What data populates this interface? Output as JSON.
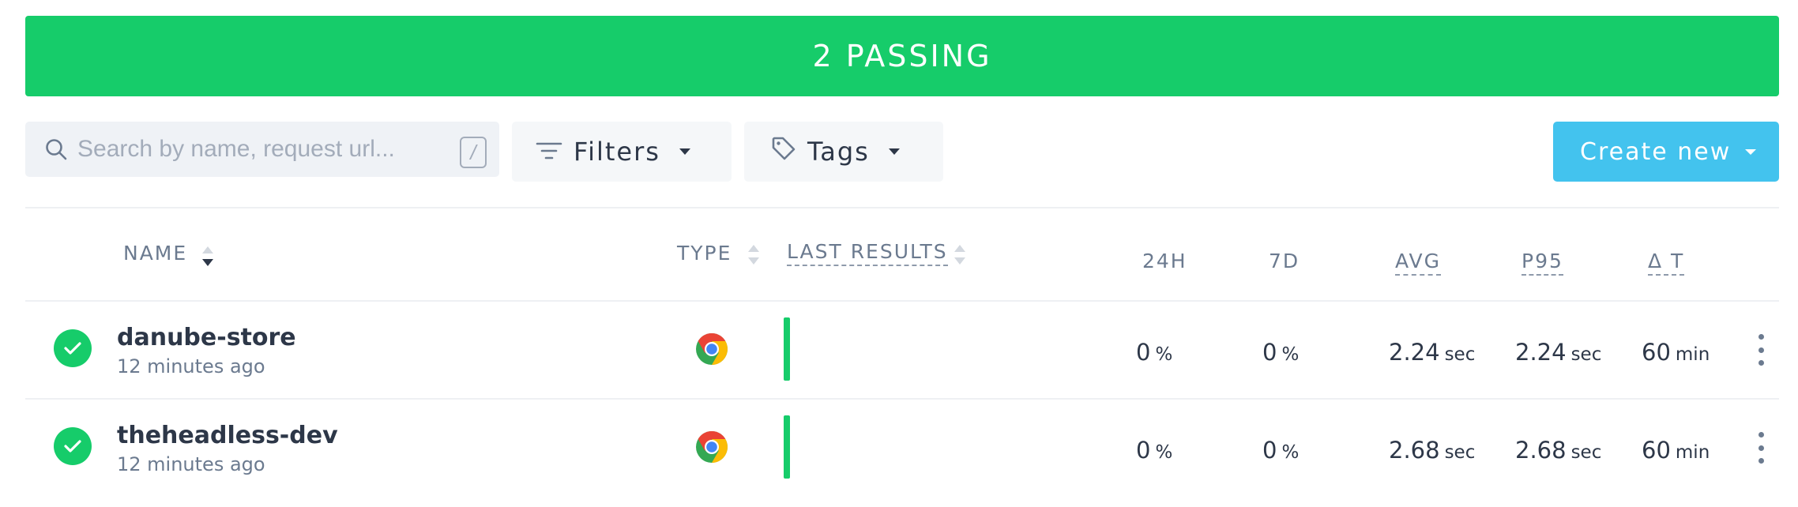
{
  "banner": {
    "text": "2 PASSING"
  },
  "toolbar": {
    "search_placeholder": "Search by name, request url...",
    "search_shortcut": "/",
    "filters_label": "Filters",
    "tags_label": "Tags",
    "create_label": "Create new"
  },
  "table": {
    "headers": {
      "name": "NAME",
      "type": "TYPE",
      "last_results": "LAST RESULTS",
      "h24": "24H",
      "d7": "7D",
      "avg": "AVG",
      "p95": "P95",
      "delta_t": "Δ T"
    },
    "rows": [
      {
        "name": "danube-store",
        "ago": "12 minutes ago",
        "type_icon": "chrome-icon",
        "status": "passing",
        "h24": "0",
        "h24_unit": "%",
        "d7": "0",
        "d7_unit": "%",
        "avg": "2.24",
        "avg_unit": "sec",
        "p95": "2.24",
        "p95_unit": "sec",
        "dt": "60",
        "dt_unit": "min"
      },
      {
        "name": "theheadless-dev",
        "ago": "12 minutes ago",
        "type_icon": "chrome-icon",
        "status": "passing",
        "h24": "0",
        "h24_unit": "%",
        "d7": "0",
        "d7_unit": "%",
        "avg": "2.68",
        "avg_unit": "sec",
        "p95": "2.68",
        "p95_unit": "sec",
        "dt": "60",
        "dt_unit": "min"
      }
    ]
  },
  "colors": {
    "success": "#16cc6a",
    "accent": "#43c3ee",
    "muted": "#6b7a8f",
    "text": "#2d3748"
  }
}
